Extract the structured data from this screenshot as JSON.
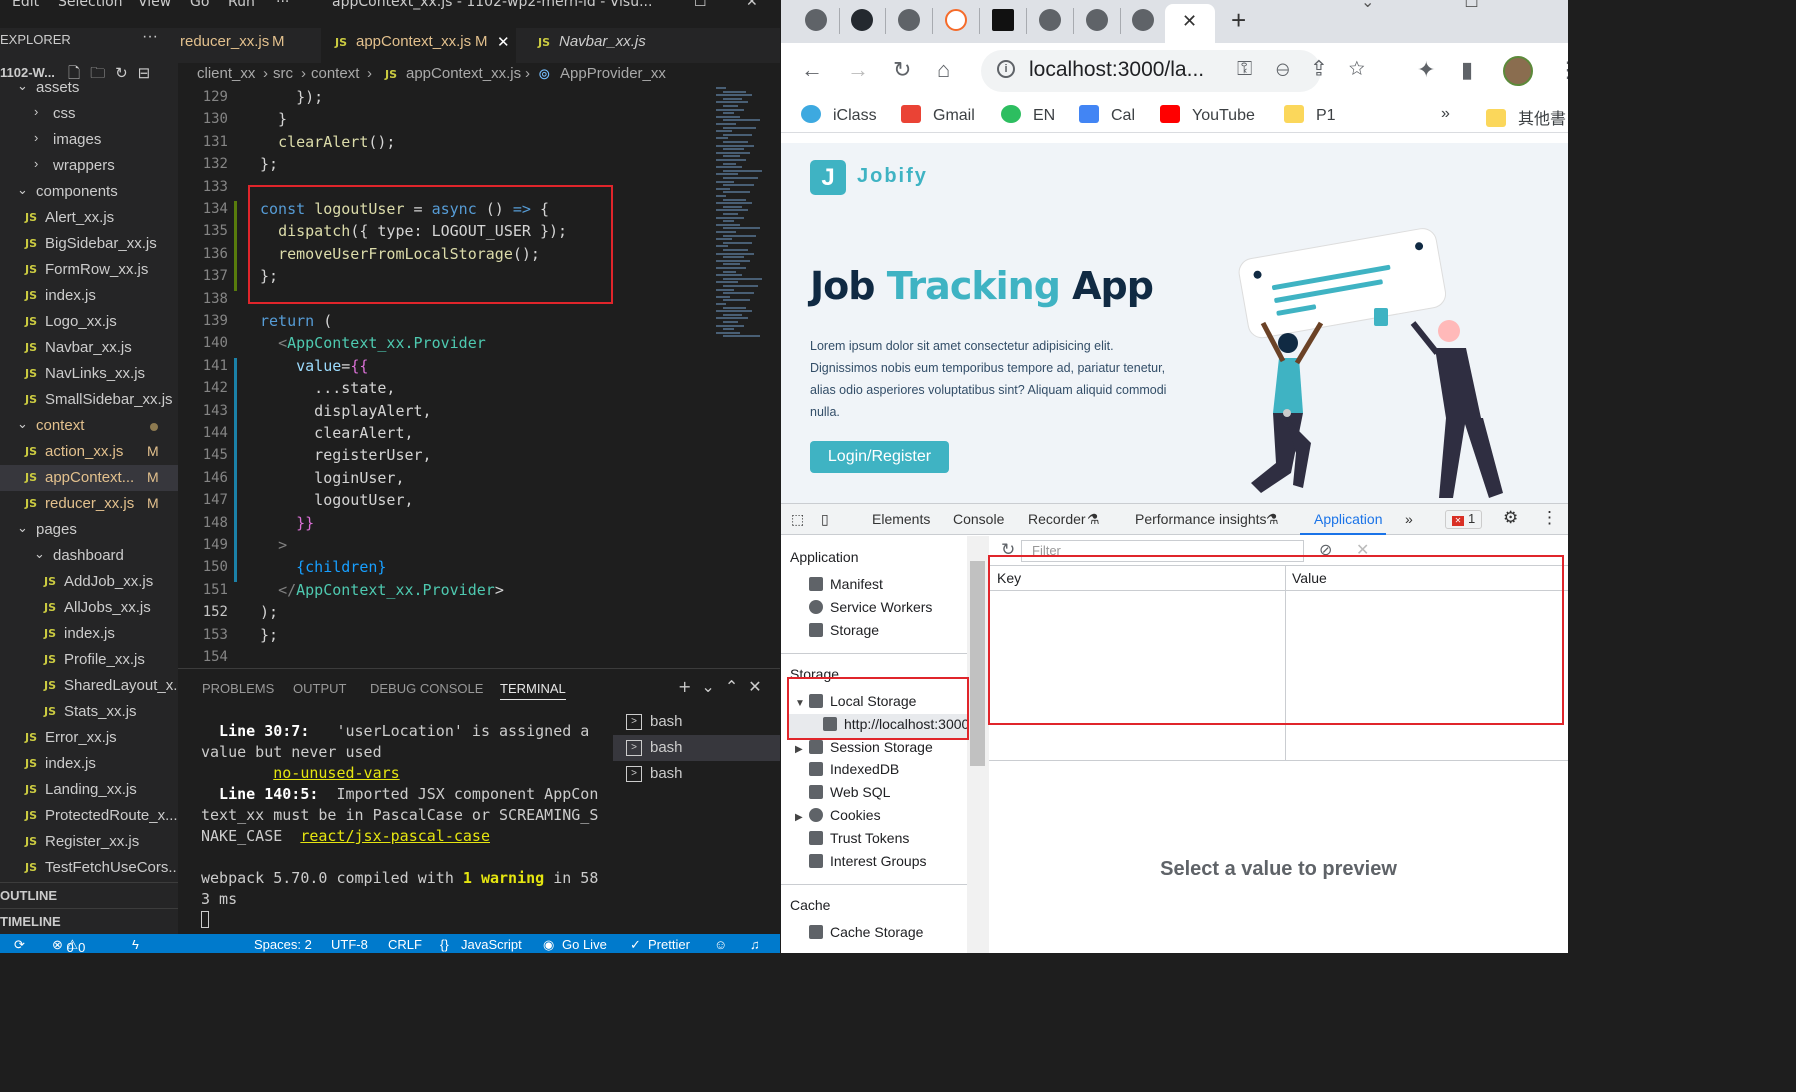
{
  "vscode": {
    "menu": [
      "Edit",
      "Selection",
      "View",
      "Go",
      "Run",
      "···"
    ],
    "window_title": "appContext_xx.js - 1102-wp2-mern-id - Visu...",
    "explorer_title": "EXPLORER",
    "project_name": "1102-W...",
    "tree": [
      {
        "label": "assets",
        "depth": 1,
        "type": "folder",
        "open": true
      },
      {
        "label": "css",
        "depth": 2,
        "type": "folder",
        "open": false
      },
      {
        "label": "images",
        "depth": 2,
        "type": "folder",
        "open": false
      },
      {
        "label": "wrappers",
        "depth": 2,
        "type": "folder",
        "open": false
      },
      {
        "label": "components",
        "depth": 1,
        "type": "folder",
        "open": true
      },
      {
        "label": "Alert_xx.js",
        "depth": 2,
        "type": "file"
      },
      {
        "label": "BigSidebar_xx.js",
        "depth": 2,
        "type": "file"
      },
      {
        "label": "FormRow_xx.js",
        "depth": 2,
        "type": "file"
      },
      {
        "label": "index.js",
        "depth": 2,
        "type": "file"
      },
      {
        "label": "Logo_xx.js",
        "depth": 2,
        "type": "file"
      },
      {
        "label": "Navbar_xx.js",
        "depth": 2,
        "type": "file"
      },
      {
        "label": "NavLinks_xx.js",
        "depth": 2,
        "type": "file"
      },
      {
        "label": "SmallSidebar_xx.js",
        "depth": 2,
        "type": "file"
      },
      {
        "label": "context",
        "depth": 1,
        "type": "folder",
        "open": true,
        "modified_dot": true
      },
      {
        "label": "action_xx.js",
        "depth": 2,
        "type": "file",
        "badge": "M"
      },
      {
        "label": "appContext...",
        "depth": 2,
        "type": "file",
        "badge": "M",
        "selected": true
      },
      {
        "label": "reducer_xx.js",
        "depth": 2,
        "type": "file",
        "badge": "M"
      },
      {
        "label": "pages",
        "depth": 1,
        "type": "folder",
        "open": true
      },
      {
        "label": "dashboard",
        "depth": 2,
        "type": "folder",
        "open": true
      },
      {
        "label": "AddJob_xx.js",
        "depth": 3,
        "type": "file"
      },
      {
        "label": "AllJobs_xx.js",
        "depth": 3,
        "type": "file"
      },
      {
        "label": "index.js",
        "depth": 3,
        "type": "file"
      },
      {
        "label": "Profile_xx.js",
        "depth": 3,
        "type": "file"
      },
      {
        "label": "SharedLayout_x...",
        "depth": 3,
        "type": "file"
      },
      {
        "label": "Stats_xx.js",
        "depth": 3,
        "type": "file"
      },
      {
        "label": "Error_xx.js",
        "depth": 2,
        "type": "file"
      },
      {
        "label": "index.js",
        "depth": 2,
        "type": "file"
      },
      {
        "label": "Landing_xx.js",
        "depth": 2,
        "type": "file"
      },
      {
        "label": "ProtectedRoute_x...",
        "depth": 2,
        "type": "file"
      },
      {
        "label": "Register_xx.js",
        "depth": 2,
        "type": "file"
      },
      {
        "label": "TestFetchUseCors...",
        "depth": 2,
        "type": "file"
      }
    ],
    "outline_label": "OUTLINE",
    "timeline_label": "TIMELINE",
    "js_badge": "JS",
    "tabs": [
      {
        "label": "reducer_xx.js",
        "badge": "M",
        "active": false,
        "italic": false
      },
      {
        "label": "appContext_xx.js",
        "badge": "M",
        "active": true,
        "italic": false,
        "close": "✕"
      },
      {
        "label": "Navbar_xx.js",
        "badge": "",
        "active": false,
        "italic": true
      }
    ],
    "breadcrumb": [
      "client_xx",
      "src",
      "context",
      "appContext_xx.js",
      "AppProvider_xx"
    ],
    "code_lines": [
      {
        "n": 129,
        "text": "    });"
      },
      {
        "n": 130,
        "text": "  }"
      },
      {
        "n": 131,
        "text": "  clearAlert();"
      },
      {
        "n": 132,
        "text": "};"
      },
      {
        "n": 133,
        "text": ""
      },
      {
        "n": 134,
        "text": "const logoutUser = async () => {"
      },
      {
        "n": 135,
        "text": "  dispatch({ type: LOGOUT_USER });"
      },
      {
        "n": 136,
        "text": "  removeUserFromLocalStorage();"
      },
      {
        "n": 137,
        "text": "};"
      },
      {
        "n": 138,
        "text": ""
      },
      {
        "n": 139,
        "text": "return ("
      },
      {
        "n": 140,
        "text": "  <AppContext_xx.Provider"
      },
      {
        "n": 141,
        "text": "    value={{"
      },
      {
        "n": 142,
        "text": "      ...state,"
      },
      {
        "n": 143,
        "text": "      displayAlert,"
      },
      {
        "n": 144,
        "text": "      clearAlert,"
      },
      {
        "n": 145,
        "text": "      registerUser,"
      },
      {
        "n": 146,
        "text": "      loginUser,"
      },
      {
        "n": 147,
        "text": "      logoutUser,"
      },
      {
        "n": 148,
        "text": "    }}"
      },
      {
        "n": 149,
        "text": "  >"
      },
      {
        "n": 150,
        "text": "    {children}"
      },
      {
        "n": 151,
        "text": "  </AppContext_xx.Provider>"
      },
      {
        "n": 152,
        "text": ");"
      },
      {
        "n": 153,
        "text": "};"
      },
      {
        "n": 154,
        "text": ""
      }
    ],
    "current_line": 152,
    "panel_tabs": [
      "PROBLEMS",
      "OUTPUT",
      "DEBUG CONSOLE",
      "TERMINAL"
    ],
    "panel_active": "TERMINAL",
    "terminal": {
      "l1_bold": "  Line 30:7:",
      "l1_rest": "   'userLocation' is assigned a",
      "l2": "value but never used",
      "l3_rule": "no-unused-vars",
      "l4_bold": "  Line 140:5:",
      "l4_rest": "  Imported JSX component AppCon",
      "l5": "text_xx must be in PascalCase or SCREAMING_S",
      "l6_pre": "NAKE_CASE",
      "l6_rule": "react/jsx-pascal-case",
      "l8_pre": "webpack 5.70.0 compiled with ",
      "l8_warn": "1 warning",
      "l8_post": " in 58",
      "l9": "3 ms"
    },
    "terminals": [
      "bash",
      "bash",
      "bash"
    ],
    "status": {
      "errors": "0",
      "warnings": "0",
      "spaces": "Spaces: 2",
      "encoding": "UTF-8",
      "eol": "CRLF",
      "language": "JavaScript",
      "golive": "Go Live",
      "prettier": "Prettier"
    }
  },
  "chrome": {
    "url": "localhost:3000/la...",
    "bookmarks": [
      "iClass",
      "Gmail",
      "EN",
      "Cal",
      "YouTube",
      "P1",
      "其他書"
    ],
    "bookmarks_more": "»",
    "page": {
      "logo_letter": "J",
      "brand": "Jobify",
      "title_a": "Job ",
      "title_b": "Tracking",
      "title_c": " App",
      "text": "Lorem ipsum dolor sit amet consectetur adipisicing elit. Dignissimos nobis eum temporibus tempore ad, pariatur tenetur, alias odio asperiores voluptatibus sint? Aliquam aliquid commodi nulla.",
      "button": "Login/Register"
    },
    "devtools": {
      "tabs": [
        "Elements",
        "Console",
        "Recorder",
        "Performance insights",
        "Application"
      ],
      "active_tab": "Application",
      "more": "»",
      "error_count": "1",
      "sections": {
        "application": "Application",
        "app_items": [
          "Manifest",
          "Service Workers",
          "Storage"
        ],
        "storage": "Storage",
        "local_storage": "Local Storage",
        "local_origin": "http://localhost:3000",
        "storage_items": [
          "Session Storage",
          "IndexedDB",
          "Web SQL",
          "Cookies",
          "Trust Tokens",
          "Interest Groups"
        ],
        "cache": "Cache",
        "cache_items": [
          "Cache Storage"
        ]
      },
      "filter_placeholder": "Filter",
      "col_key": "Key",
      "col_value": "Value",
      "preview": "Select a value to preview"
    }
  }
}
